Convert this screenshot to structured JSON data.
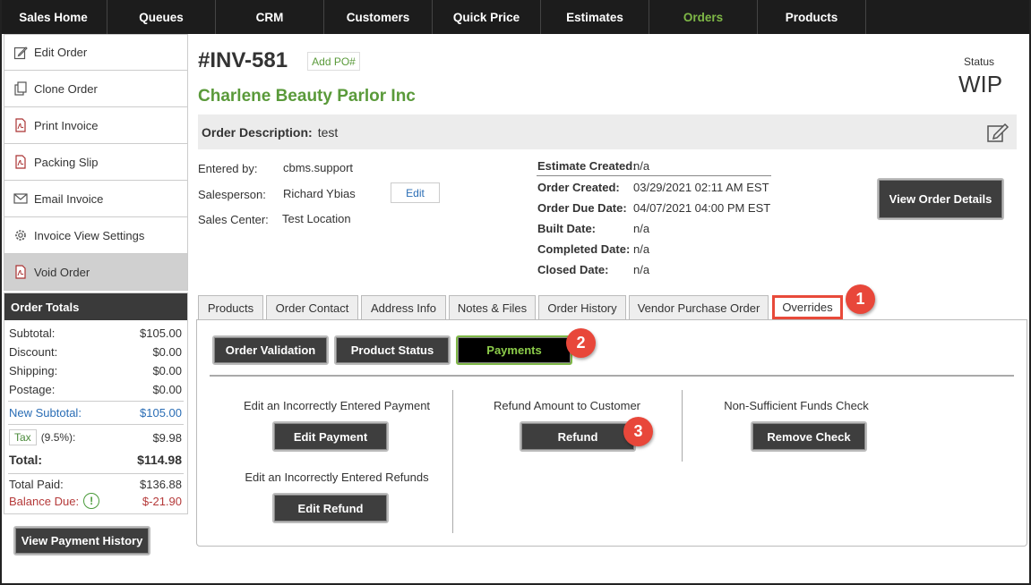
{
  "nav": {
    "items": [
      {
        "label": "Sales Home"
      },
      {
        "label": "Queues"
      },
      {
        "label": "CRM"
      },
      {
        "label": "Customers"
      },
      {
        "label": "Quick Price"
      },
      {
        "label": "Estimates"
      },
      {
        "label": "Orders"
      },
      {
        "label": "Products"
      }
    ],
    "active": "Orders"
  },
  "sidebar": {
    "items": [
      {
        "label": "Edit Order",
        "icon": "pencil-icon"
      },
      {
        "label": "Clone Order",
        "icon": "copy-icon"
      },
      {
        "label": "Print Invoice",
        "icon": "pdf-icon"
      },
      {
        "label": "Packing Slip",
        "icon": "pdf-icon"
      },
      {
        "label": "Email Invoice",
        "icon": "envelope-icon"
      },
      {
        "label": "Invoice View Settings",
        "icon": "gear-icon"
      },
      {
        "label": "Void Order",
        "icon": "pdf-icon"
      }
    ]
  },
  "totals": {
    "title": "Order Totals",
    "subtotal_label": "Subtotal:",
    "subtotal": "$105.00",
    "discount_label": "Discount:",
    "discount": "$0.00",
    "shipping_label": "Shipping:",
    "shipping": "$0.00",
    "postage_label": "Postage:",
    "postage": "$0.00",
    "new_subtotal_label": "New Subtotal:",
    "new_subtotal": "$105.00",
    "tax_label": "Tax",
    "tax_rate": "(9.5%):",
    "tax": "$9.98",
    "total_label": "Total:",
    "total": "$114.98",
    "total_paid_label": "Total Paid:",
    "total_paid": "$136.88",
    "balance_due_label": "Balance Due:",
    "balance_due": "$-21.90"
  },
  "payment_history_button": "View Payment History",
  "order": {
    "number": "#INV-581",
    "add_po": "Add PO#",
    "company": "Charlene Beauty Parlor Inc",
    "status_label": "Status",
    "status": "WIP",
    "description_label": "Order Description:",
    "description": "test",
    "entered_by_label": "Entered by:",
    "entered_by": "cbms.support",
    "salesperson_label": "Salesperson:",
    "salesperson": "Richard Ybias",
    "edit_label": "Edit",
    "sales_center_label": "Sales Center:",
    "sales_center": "Test Location",
    "estimate_created_label": "Estimate Created:",
    "estimate_created": "n/a",
    "order_created_label": "Order Created:",
    "order_created": "03/29/2021 02:11 AM EST",
    "order_due_label": "Order Due Date:",
    "order_due": "04/07/2021 04:00 PM EST",
    "built_label": "Built Date:",
    "built": "n/a",
    "completed_label": "Completed Date:",
    "completed": "n/a",
    "closed_label": "Closed Date:",
    "closed": "n/a",
    "view_details_button": "View Order Details"
  },
  "tabs": [
    {
      "label": "Products"
    },
    {
      "label": "Order Contact"
    },
    {
      "label": "Address Info"
    },
    {
      "label": "Notes & Files"
    },
    {
      "label": "Order History"
    },
    {
      "label": "Vendor Purchase Order"
    },
    {
      "label": "Overrides"
    }
  ],
  "overrides": {
    "subtabs": [
      {
        "label": "Order Validation"
      },
      {
        "label": "Product Status"
      },
      {
        "label": "Payments"
      }
    ],
    "edit_payment_text": "Edit an Incorrectly Entered Payment",
    "edit_payment_button": "Edit Payment",
    "edit_refund_text": "Edit an Incorrectly Entered Refunds",
    "edit_refund_button": "Edit Refund",
    "refund_text": "Refund Amount to Customer",
    "refund_button": "Refund",
    "nsf_text": "Non-Sufficient Funds Check",
    "remove_check_button": "Remove Check"
  },
  "badges": [
    "1",
    "2",
    "3"
  ],
  "colors": {
    "accent_green": "#5a9a3a",
    "badge_red": "#e8473a",
    "nav_dark": "#1c1c1c"
  }
}
